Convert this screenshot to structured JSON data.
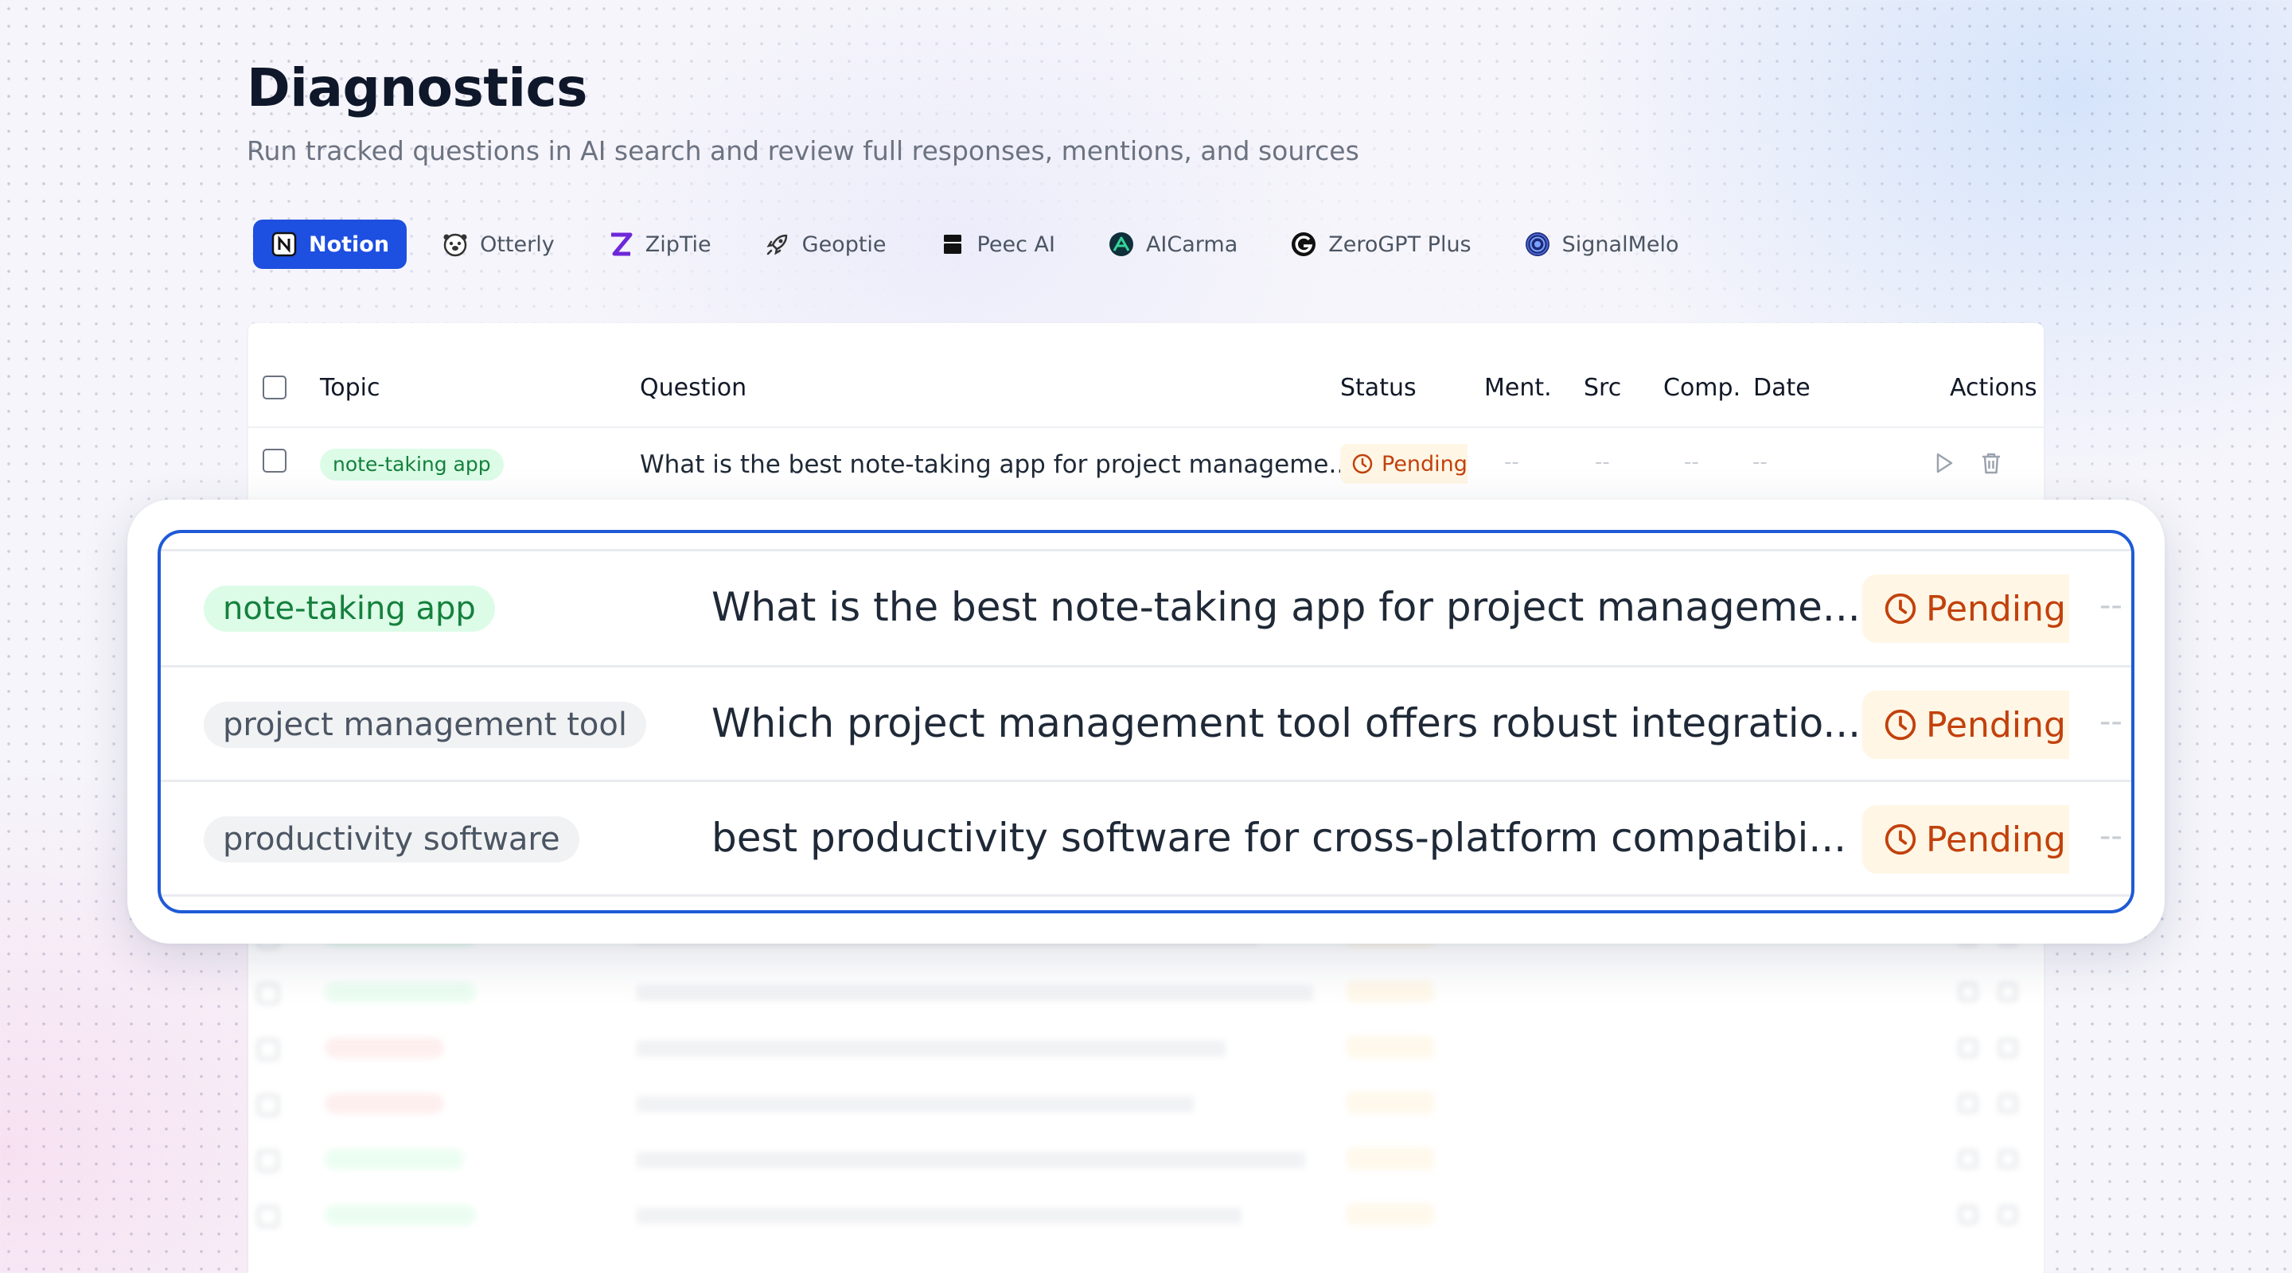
{
  "header": {
    "title": "Diagnostics",
    "subtitle": "Run tracked questions in AI search and review full responses, mentions, and sources"
  },
  "tabs": [
    {
      "label": "Notion",
      "icon": "notion-icon",
      "active": true
    },
    {
      "label": "Otterly",
      "icon": "otter-icon",
      "active": false
    },
    {
      "label": "ZipTie",
      "icon": "ziptie-icon",
      "active": false
    },
    {
      "label": "Geoptie",
      "icon": "rocket-icon",
      "active": false
    },
    {
      "label": "Peec AI",
      "icon": "peec-icon",
      "active": false
    },
    {
      "label": "AICarma",
      "icon": "aicarma-icon",
      "active": false
    },
    {
      "label": "ZeroGPT Plus",
      "icon": "zerogpt-icon",
      "active": false
    },
    {
      "label": "SignalMelo",
      "icon": "signal-icon",
      "active": false
    }
  ],
  "table": {
    "columns": {
      "topic": "Topic",
      "question": "Question",
      "status": "Status",
      "mentions": "Ment.",
      "sources": "Src",
      "competitors": "Comp.",
      "date": "Date",
      "actions": "Actions"
    },
    "rows": [
      {
        "topic": "note-taking app",
        "question": "What is the best note-taking app for project manageme...",
        "status": "Pending",
        "mentions": "--",
        "sources": "--",
        "competitors": "--",
        "date": "--"
      }
    ]
  },
  "zoom": {
    "rows": [
      {
        "topic": "note-taking app",
        "topic_color": "green",
        "question": "What is the best note-taking app for project manageme...",
        "status": "Pending",
        "mentions": "--"
      },
      {
        "topic": "project management tool",
        "topic_color": "gray",
        "question": "Which project management tool offers robust integratio...",
        "status": "Pending",
        "mentions": "--"
      },
      {
        "topic": "productivity software",
        "topic_color": "gray",
        "question": "best productivity software for cross-platform compatibi...",
        "status": "Pending",
        "mentions": "--"
      }
    ]
  },
  "colors": {
    "accent": "#1d4fe0",
    "pending_bg": "#fff6e5",
    "pending_text": "#c2410c",
    "topic_green_bg": "#dcfce7",
    "topic_green_text": "#15803d"
  }
}
